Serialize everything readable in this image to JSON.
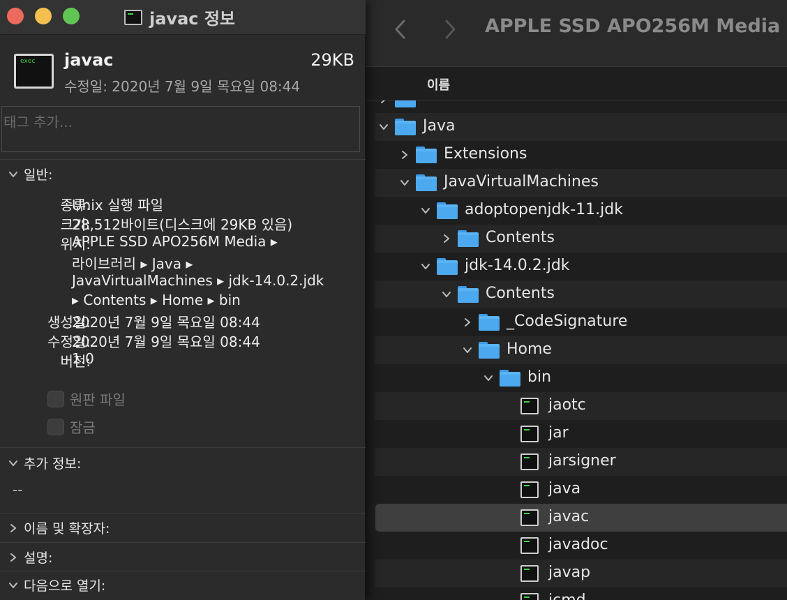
{
  "finder": {
    "title": "APPLE SSD APO256M Media",
    "column_header": "이름",
    "rows": [
      {
        "label": "",
        "indent": 0,
        "type": "folder",
        "expanded": false,
        "partial": true
      },
      {
        "label": "Java",
        "indent": 0,
        "type": "folder",
        "expanded": true
      },
      {
        "label": "Extensions",
        "indent": 1,
        "type": "folder",
        "expanded": false
      },
      {
        "label": "JavaVirtualMachines",
        "indent": 1,
        "type": "folder",
        "expanded": true
      },
      {
        "label": "adoptopenjdk-11.jdk",
        "indent": 2,
        "type": "folder",
        "expanded": true
      },
      {
        "label": "Contents",
        "indent": 3,
        "type": "folder",
        "expanded": false
      },
      {
        "label": "jdk-14.0.2.jdk",
        "indent": 2,
        "type": "folder",
        "expanded": true
      },
      {
        "label": "Contents",
        "indent": 3,
        "type": "folder",
        "expanded": true
      },
      {
        "label": "_CodeSignature",
        "indent": 4,
        "type": "folder",
        "expanded": false
      },
      {
        "label": "Home",
        "indent": 4,
        "type": "folder",
        "expanded": true
      },
      {
        "label": "bin",
        "indent": 5,
        "type": "folder",
        "expanded": true
      },
      {
        "label": "jaotc",
        "indent": 6,
        "type": "exec"
      },
      {
        "label": "jar",
        "indent": 6,
        "type": "exec"
      },
      {
        "label": "jarsigner",
        "indent": 6,
        "type": "exec"
      },
      {
        "label": "java",
        "indent": 6,
        "type": "exec"
      },
      {
        "label": "javac",
        "indent": 6,
        "type": "exec",
        "selected": true
      },
      {
        "label": "javadoc",
        "indent": 6,
        "type": "exec"
      },
      {
        "label": "javap",
        "indent": 6,
        "type": "exec"
      },
      {
        "label": "jcmd",
        "indent": 6,
        "type": "exec"
      }
    ]
  },
  "info": {
    "window_title": "javac 정보",
    "icon_text": "exec",
    "file_name": "javac",
    "file_size": "29KB",
    "modified_line": "수정일: 2020년 7월 9일 목요일 08:44",
    "tags_placeholder": "태그 추가...",
    "general": {
      "header": "일반:",
      "kind_label": "종류:",
      "kind_value": "Unix 실행 파일",
      "size_label": "크기:",
      "size_value": "28,512바이트(디스크에 29KB 있음)",
      "location_label": "위치:",
      "location_line1": "APPLE SSD APO256M Media ▸",
      "location_line2": "라이브러리 ▸ Java ▸",
      "location_line3": "JavaVirtualMachines ▸ jdk-14.0.2.jdk",
      "location_line4": "▸ Contents ▸ Home ▸ bin",
      "created_label": "생성일:",
      "created_value": "2020년 7월 9일 목요일 08:44",
      "modified_label": "수정일:",
      "modified_value": "2020년 7월 9일 목요일 08:44",
      "version_label": "버전:",
      "version_value": "1.0",
      "stationery_label": "원판 파일",
      "locked_label": "잠금"
    },
    "more_info": {
      "header": "추가 정보:",
      "value": "--"
    },
    "name_ext": {
      "header": "이름 및 확장자:"
    },
    "comments": {
      "header": "설명:"
    },
    "open_with": {
      "header": "다음으로 열기:"
    }
  }
}
